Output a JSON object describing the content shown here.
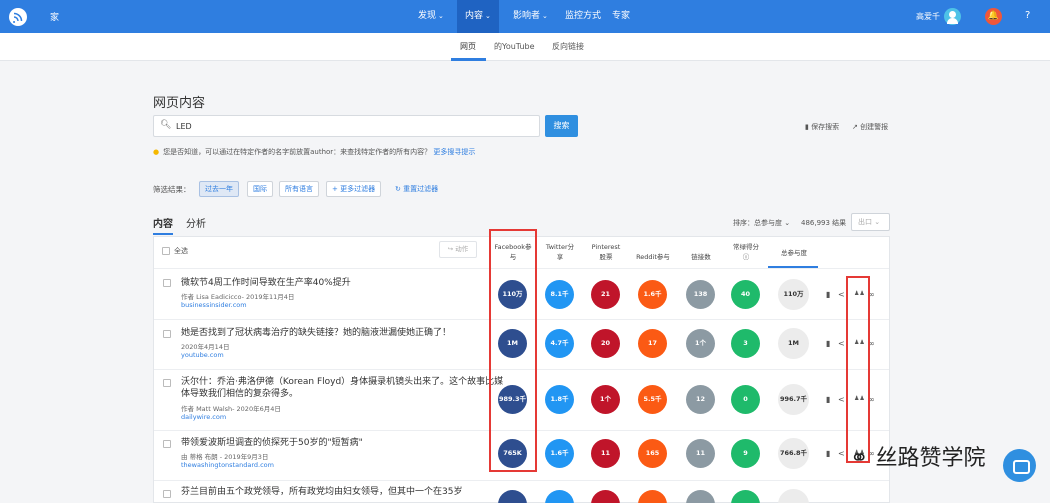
{
  "nav": {
    "home": "家",
    "items": [
      {
        "label": "发现",
        "caret": "⌄"
      },
      {
        "label": "内容",
        "caret": "⌄"
      },
      {
        "label": "影响者",
        "caret": "⌄"
      },
      {
        "label": "监控方式",
        "caret": ""
      },
      {
        "label": "专家",
        "caret": ""
      }
    ],
    "user": "高爱千",
    "bell": "🔔",
    "help": "?"
  },
  "subtabs": [
    "网页",
    "的YouTube",
    "反向链接"
  ],
  "page_title": "网页内容",
  "search": {
    "value": "LED",
    "button": "搜索"
  },
  "save_search": "保存搜索",
  "create_alert": "创建警报",
  "tip": {
    "text": "您是否知道，可以通过在特定作者的名字前放置author：来查找特定作者的所有内容？",
    "link": "更多搜寻提示"
  },
  "filter": {
    "label": "筛选结果：",
    "chips": [
      "过去一年",
      "国际",
      "所有语言",
      "+ 更多过滤器"
    ],
    "reset": "重置过滤器"
  },
  "tabs": {
    "content": "内容",
    "analysis": "分析"
  },
  "sort": {
    "label": "排序：总参与度 ⌄",
    "count": "486,993 结果",
    "export": "出口 ⌄"
  },
  "table": {
    "select_all": "全选",
    "action": "动作",
    "columns": [
      [
        "Facebook参",
        "与"
      ],
      [
        "Twitter分",
        "享"
      ],
      [
        "Pinterest",
        "股票"
      ],
      [
        "Reddit参与",
        ""
      ],
      [
        "链接数",
        ""
      ],
      [
        "常绿得分",
        "ⓘ"
      ],
      [
        "总参与度",
        ""
      ]
    ],
    "rows": [
      {
        "title": "微软节4周工作时间导致在生产率40%提升",
        "meta": "作者 Lisa Eadicicco- 2019年11月4日",
        "domain": "businessinsider.com",
        "values": [
          "110万",
          "8.1千",
          "21",
          "1.6千",
          "138",
          "40",
          "110万"
        ]
      },
      {
        "title": "她是否找到了冠状病毒治疗的缺失链接？她的脑液泄漏使她正确了！",
        "meta": "2020年4月14日",
        "domain": "youtube.com",
        "values": [
          "1M",
          "4.7千",
          "20",
          "17",
          "1个",
          "3",
          "1M"
        ]
      },
      {
        "title": "沃尔什：乔治·弗洛伊德（Korean Floyd）身体摄录机镜头出来了。这个故事比媒体导致我们相信的复杂得多。",
        "meta": "作者 Matt Walsh- 2020年6月4日",
        "domain": "dailywire.com",
        "values": [
          "989.3千",
          "1.8千",
          "1个",
          "5.5千",
          "12",
          "0",
          "996.7千"
        ]
      },
      {
        "title": "带领爱波斯坦调查的侦探死于50岁的\"短暂病\"",
        "meta": "由 蒂格 布朗 - 2019年9月3日",
        "domain": "thewashingtonstandard.com",
        "values": [
          "765K",
          "1.6千",
          "11",
          "165",
          "11",
          "9",
          "766.8千"
        ]
      },
      {
        "title": "芬兰目前由五个政党领导，所有政党均由妇女领导，但其中一个在35岁",
        "meta": "",
        "domain": "",
        "values": [
          "",
          "",
          "",
          "",
          "",
          "",
          ""
        ]
      }
    ]
  },
  "colors": {
    "facebook": "#2e4e8f",
    "twitter": "#2196f3",
    "pinterest": "#c0152a",
    "reddit": "#fb5a14",
    "links": "#8c9aa3",
    "evergreen": "#1fba6b"
  },
  "watermark": "丝路赞学院"
}
